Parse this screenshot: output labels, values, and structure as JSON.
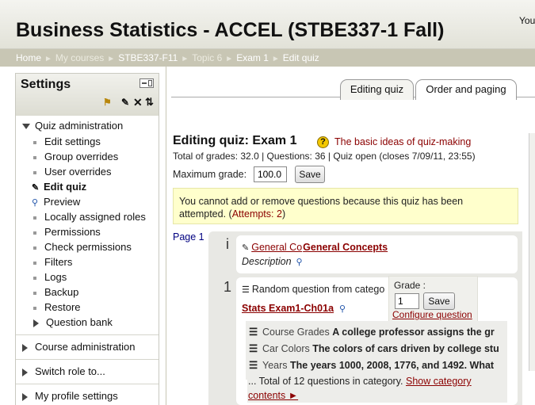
{
  "header": {
    "site_title": "Business Statistics - ACCEL (STBE337-1 Fall)",
    "login_text": "You"
  },
  "breadcrumb": [
    {
      "label": "Home",
      "dim": false
    },
    {
      "label": "My courses",
      "dim": true
    },
    {
      "label": "STBE337-F11",
      "dim": false
    },
    {
      "label": "Topic 6",
      "dim": true
    },
    {
      "label": "Exam 1",
      "dim": false
    },
    {
      "label": "Edit quiz",
      "dim": false
    }
  ],
  "breadcrumb_separator": "►",
  "settings": {
    "title": "Settings",
    "quiz_admin_label": "Quiz administration",
    "items": [
      "Edit settings",
      "Group overrides",
      "User overrides",
      "Edit quiz",
      "Preview",
      "Locally assigned roles",
      "Permissions",
      "Check permissions",
      "Filters",
      "Logs",
      "Backup",
      "Restore",
      "Question bank"
    ],
    "sections": [
      "Course administration",
      "Switch role to...",
      "My profile settings"
    ]
  },
  "tabs": [
    "Editing quiz",
    "Order and paging"
  ],
  "quiz": {
    "heading": "Editing quiz: Exam 1",
    "help_link": "The basic ideas of quiz-making",
    "status_line": "Total of grades: 32.0 | Questions: 36 | Quiz open (closes 7/09/11, 23:55)",
    "max_grade_label": "Maximum grade:",
    "max_grade_value": "100.0",
    "save_label": "Save"
  },
  "notice": {
    "text": "You cannot add or remove questions because this quiz has been attempted. (",
    "attempts_link": "Attempts: 2",
    "close": ")"
  },
  "page": {
    "label": "Page 1",
    "q1_num": "i",
    "q1_link_a": "General Co",
    "q1_link_b": "General Concepts",
    "q1_type": "Description",
    "q2_num": "1",
    "q2_text": "Random question from catego",
    "q2_link": "Stats Exam1-Ch01a",
    "grade_label": "Grade :",
    "grade_value": "1",
    "grade_save": "Save",
    "configure_link": "Configure question",
    "random_items": [
      {
        "name": "Course Grades",
        "text": "A college professor assigns the gr"
      },
      {
        "name": "Car Colors",
        "text": "The colors of cars driven by college stu"
      },
      {
        "name": "Years",
        "text": "The years 1000, 2008, 1776, and 1492. What"
      }
    ],
    "total_text": "... Total of 12 questions in category.",
    "show_category_link": "Show category contents ►"
  }
}
